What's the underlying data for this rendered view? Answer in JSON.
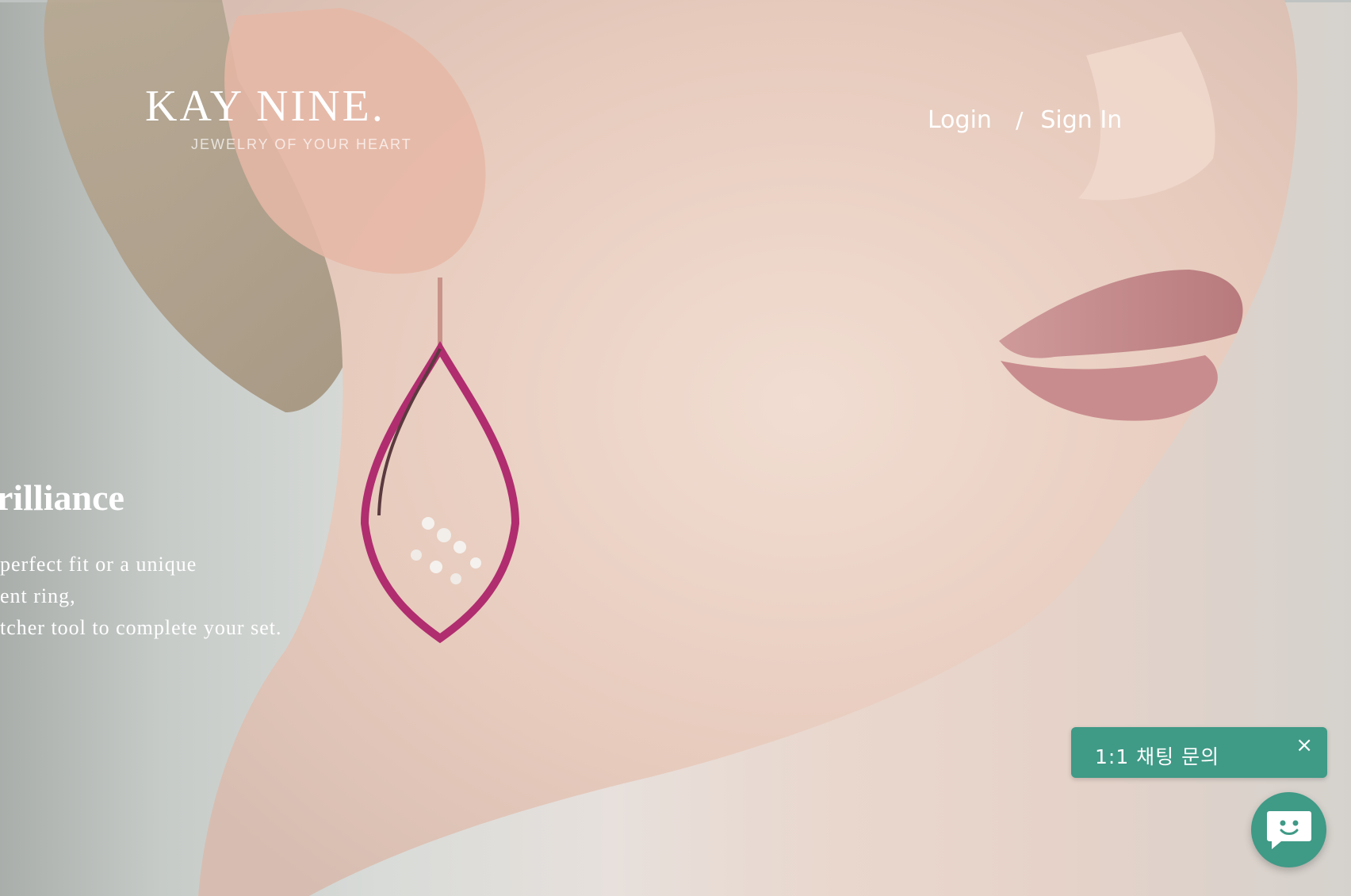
{
  "header": {
    "logo_text": "KAY NINE.",
    "logo_tagline": "JEWELRY OF YOUR HEART",
    "nav": {
      "login_label": "Login",
      "separator": "/",
      "signin_label": "Sign In"
    }
  },
  "hero": {
    "title": "rilliance",
    "lines": [
      "perfect fit or a unique",
      "ent ring,",
      "tcher tool to complete your set."
    ]
  },
  "chat": {
    "banner_label": "1:1 채팅 문의",
    "close_label": "×",
    "accent_color": "#3f9a86"
  },
  "icons": {
    "chat_fab": "chat-bubble-smile-icon",
    "close": "close-icon"
  }
}
